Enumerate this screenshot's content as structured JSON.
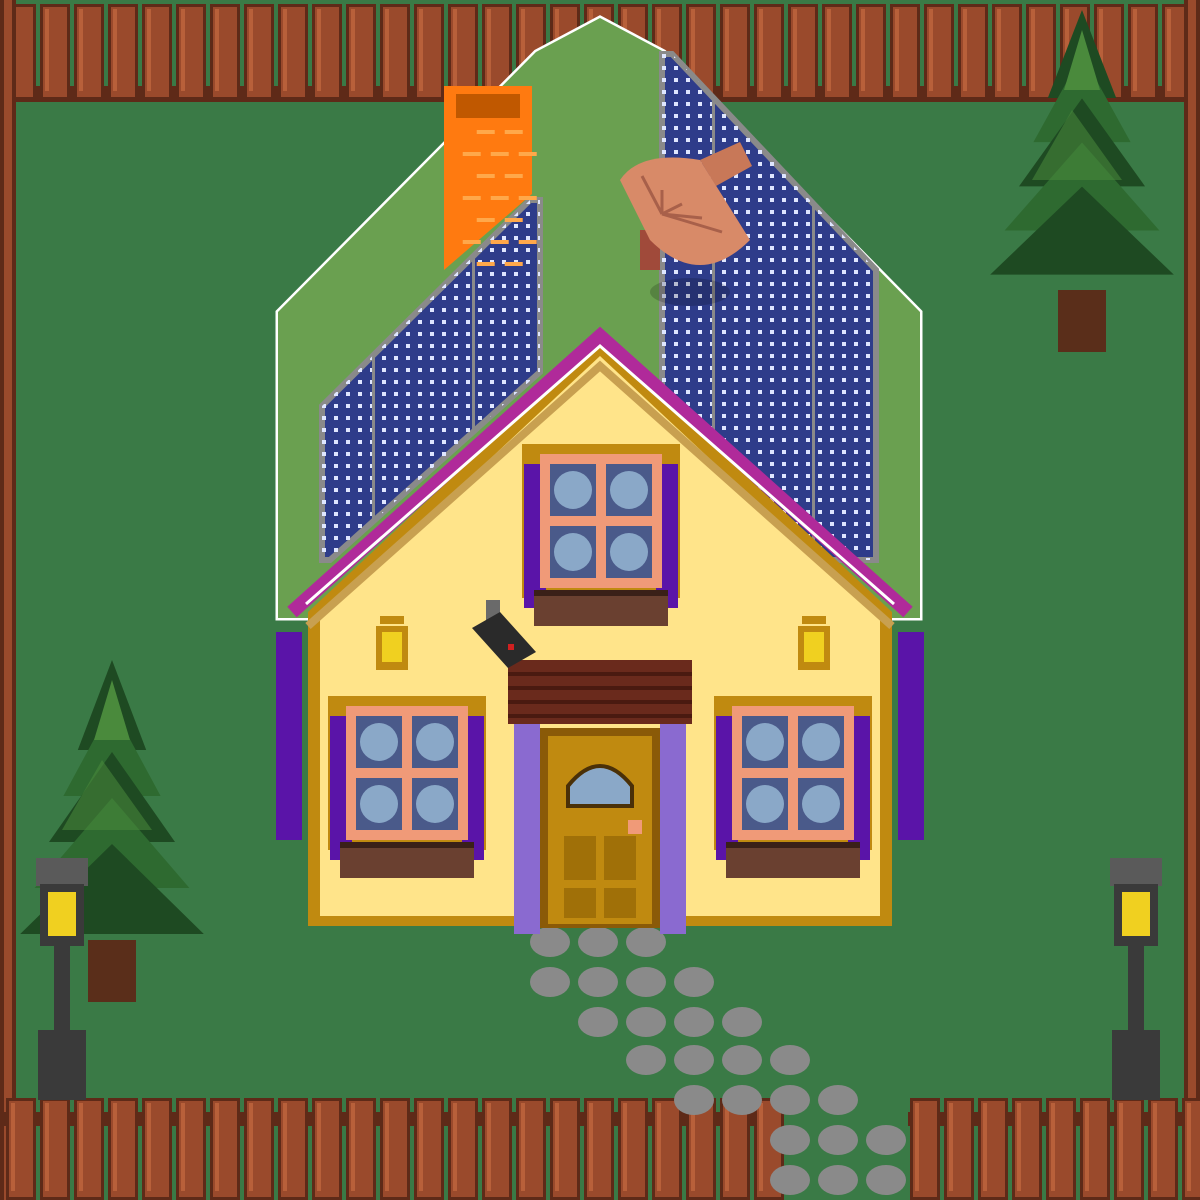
{
  "scene": {
    "kind": "top-down pixel-art house plot",
    "colors": {
      "grass": "#3a7a46",
      "fence_plank": "#9a4a2c",
      "fence_dark": "#5e2a18",
      "fence_highlight": "#b8603a",
      "roof_green": "#6aa050",
      "solar_panel": "#2e3c8a",
      "solar_cell_dot": "#dfe6ff",
      "solar_frame": "#8a8a8a",
      "chimney": "#ff7a10",
      "chimney_mortar": "#ffa84a",
      "dish": "#d88a68",
      "house_wall": "#ffe48a",
      "house_trim": "#c08a10",
      "roof_edge_magenta": "#b02a9a",
      "shutter_purple": "#5a14a8",
      "window_frame": "#f09a78",
      "window_glass": "#8aa8c8",
      "planter": "#6a4030",
      "awning": "#6a2a1c",
      "door": "#c08a10",
      "door_pillar": "#8a6ad0",
      "lamp_post": "#3a3a3a",
      "lamp_light": "#f0d020",
      "path_stone": "#8a8a8a",
      "tree_dark": "#1e4a22",
      "tree_mid": "#2e6a30",
      "tree_light": "#4a8a3c",
      "trunk": "#5a2e1a"
    },
    "objects": {
      "fence": "wooden-picket-fence",
      "house": "yellow-cottage",
      "roof": "green-gable-roof",
      "solar": "solar-panel",
      "chimney": "brick-chimney",
      "dish": "satellite-dish",
      "camera": "security-camera",
      "door": "front-door",
      "windows": [
        "upper-window",
        "left-window",
        "right-window"
      ],
      "wall_lamps": [
        "wall-lantern",
        "wall-lantern"
      ],
      "street_lamps": [
        "street-lamp",
        "street-lamp"
      ],
      "trees": [
        "pine-tree",
        "pine-tree"
      ],
      "path": "stepping-stone-path"
    }
  }
}
